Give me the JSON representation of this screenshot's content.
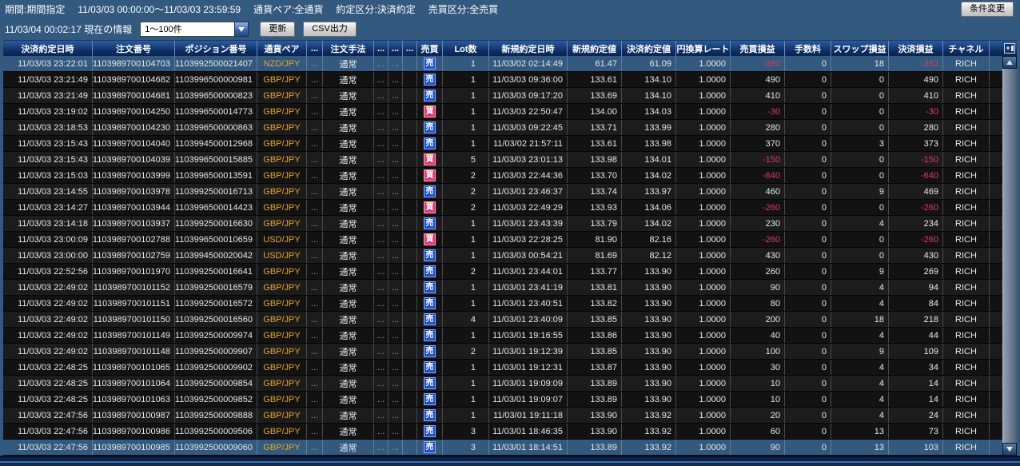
{
  "filter_bar": {
    "period_label": "期間:期間指定",
    "period_value": "11/03/03 00:00:00〜11/03/03 23:59:59",
    "pair_filter": "通貨ペア:全通貨",
    "type_filter": "約定区分:決済約定",
    "side_filter": "売買区分:全売買",
    "change_button": "条件変更"
  },
  "info_bar": {
    "timestamp": "11/03/04 00:02:17",
    "label": "現在の情報",
    "range_value": "1〜100件",
    "refresh_button": "更新",
    "csv_button": "CSV出力"
  },
  "colors": {
    "selection_blue": "#33597f",
    "sell_badge_blue": "#1d4fd6",
    "buy_badge_red": "#e8356a",
    "negative_red": "#e23a5f",
    "currency_orange": "#e2a62e",
    "header_navy": "#0d2d63"
  },
  "table": {
    "columns": [
      {
        "key": "dt",
        "label": "決済約定日時"
      },
      {
        "key": "order",
        "label": "注文番号"
      },
      {
        "key": "pos",
        "label": "ポジション番号"
      },
      {
        "key": "pair",
        "label": "通貨ペア"
      },
      {
        "key": "d1",
        "label": "..."
      },
      {
        "key": "method",
        "label": "注文手法"
      },
      {
        "key": "d2",
        "label": "..."
      },
      {
        "key": "d3",
        "label": "..."
      },
      {
        "key": "d4",
        "label": "..."
      },
      {
        "key": "side",
        "label": "売買"
      },
      {
        "key": "lots",
        "label": "Lot数"
      },
      {
        "key": "odt",
        "label": "新規約定日時"
      },
      {
        "key": "open",
        "label": "新規約定値"
      },
      {
        "key": "close",
        "label": "決済約定値"
      },
      {
        "key": "rate",
        "label": "円換算レート"
      },
      {
        "key": "pl",
        "label": "売買損益"
      },
      {
        "key": "fee",
        "label": "手数料"
      },
      {
        "key": "swap",
        "label": "スワップ損益"
      },
      {
        "key": "total",
        "label": "決済損益"
      },
      {
        "key": "ch",
        "label": "チャネル"
      }
    ],
    "rows": [
      {
        "dt": "11/03/03 23:22:01",
        "order": "1103989700104703",
        "pos": "1103992500021407",
        "pair": "NZD/JPY",
        "d1": "...",
        "method": "通常",
        "d2": "...",
        "d3": "...",
        "d4": "",
        "side": "売",
        "lots": "1",
        "odt": "11/03/02 02:14:49",
        "open": "61.47",
        "close": "61.09",
        "rate": "1.0000",
        "pl": "-380",
        "fee": "0",
        "swap": "18",
        "total": "-362",
        "ch": "RICH",
        "selected": true
      },
      {
        "dt": "11/03/03 23:21:49",
        "order": "1103989700104682",
        "pos": "1103996500000981",
        "pair": "GBP/JPY",
        "d1": "...",
        "method": "通常",
        "d2": "...",
        "d3": "...",
        "d4": "",
        "side": "売",
        "lots": "1",
        "odt": "11/03/03 09:36:00",
        "open": "133.61",
        "close": "134.10",
        "rate": "1.0000",
        "pl": "490",
        "fee": "0",
        "swap": "0",
        "total": "490",
        "ch": "RICH"
      },
      {
        "dt": "11/03/03 23:21:49",
        "order": "1103989700104681",
        "pos": "1103996500000823",
        "pair": "GBP/JPY",
        "d1": "...",
        "method": "通常",
        "d2": "...",
        "d3": "...",
        "d4": "",
        "side": "売",
        "lots": "1",
        "odt": "11/03/03 09:17:20",
        "open": "133.69",
        "close": "134.10",
        "rate": "1.0000",
        "pl": "410",
        "fee": "0",
        "swap": "0",
        "total": "410",
        "ch": "RICH"
      },
      {
        "dt": "11/03/03 23:19:02",
        "order": "1103989700104250",
        "pos": "1103996500014773",
        "pair": "GBP/JPY",
        "d1": "...",
        "method": "通常",
        "d2": "...",
        "d3": "...",
        "d4": "",
        "side": "買",
        "lots": "1",
        "odt": "11/03/03 22:50:47",
        "open": "134.00",
        "close": "134.03",
        "rate": "1.0000",
        "pl": "-30",
        "fee": "0",
        "swap": "0",
        "total": "-30",
        "ch": "RICH"
      },
      {
        "dt": "11/03/03 23:18:53",
        "order": "1103989700104230",
        "pos": "1103996500000863",
        "pair": "GBP/JPY",
        "d1": "...",
        "method": "通常",
        "d2": "...",
        "d3": "...",
        "d4": "",
        "side": "売",
        "lots": "1",
        "odt": "11/03/03 09:22:45",
        "open": "133.71",
        "close": "133.99",
        "rate": "1.0000",
        "pl": "280",
        "fee": "0",
        "swap": "0",
        "total": "280",
        "ch": "RICH"
      },
      {
        "dt": "11/03/03 23:15:43",
        "order": "1103989700104040",
        "pos": "1103994500012968",
        "pair": "GBP/JPY",
        "d1": "...",
        "method": "通常",
        "d2": "...",
        "d3": "...",
        "d4": "",
        "side": "売",
        "lots": "1",
        "odt": "11/03/02 21:57:11",
        "open": "133.61",
        "close": "133.98",
        "rate": "1.0000",
        "pl": "370",
        "fee": "0",
        "swap": "3",
        "total": "373",
        "ch": "RICH"
      },
      {
        "dt": "11/03/03 23:15:43",
        "order": "1103989700104039",
        "pos": "1103996500015885",
        "pair": "GBP/JPY",
        "d1": "...",
        "method": "通常",
        "d2": "...",
        "d3": "...",
        "d4": "",
        "side": "買",
        "lots": "5",
        "odt": "11/03/03 23:01:13",
        "open": "133.98",
        "close": "134.01",
        "rate": "1.0000",
        "pl": "-150",
        "fee": "0",
        "swap": "0",
        "total": "-150",
        "ch": "RICH"
      },
      {
        "dt": "11/03/03 23:15:03",
        "order": "1103989700103999",
        "pos": "1103996500013591",
        "pair": "GBP/JPY",
        "d1": "...",
        "method": "通常",
        "d2": "...",
        "d3": "...",
        "d4": "",
        "side": "買",
        "lots": "2",
        "odt": "11/03/03 22:44:36",
        "open": "133.70",
        "close": "134.02",
        "rate": "1.0000",
        "pl": "-640",
        "fee": "0",
        "swap": "0",
        "total": "-640",
        "ch": "RICH"
      },
      {
        "dt": "11/03/03 23:14:55",
        "order": "1103989700103978",
        "pos": "1103992500016713",
        "pair": "GBP/JPY",
        "d1": "...",
        "method": "通常",
        "d2": "...",
        "d3": "...",
        "d4": "",
        "side": "売",
        "lots": "2",
        "odt": "11/03/01 23:46:37",
        "open": "133.74",
        "close": "133.97",
        "rate": "1.0000",
        "pl": "460",
        "fee": "0",
        "swap": "9",
        "total": "469",
        "ch": "RICH"
      },
      {
        "dt": "11/03/03 23:14:27",
        "order": "1103989700103944",
        "pos": "1103996500014423",
        "pair": "GBP/JPY",
        "d1": "...",
        "method": "通常",
        "d2": "...",
        "d3": "...",
        "d4": "",
        "side": "買",
        "lots": "2",
        "odt": "11/03/03 22:49:29",
        "open": "133.93",
        "close": "134.06",
        "rate": "1.0000",
        "pl": "-260",
        "fee": "0",
        "swap": "0",
        "total": "-260",
        "ch": "RICH"
      },
      {
        "dt": "11/03/03 23:14:18",
        "order": "1103989700103937",
        "pos": "1103992500016630",
        "pair": "GBP/JPY",
        "d1": "...",
        "method": "通常",
        "d2": "...",
        "d3": "...",
        "d4": "",
        "side": "売",
        "lots": "1",
        "odt": "11/03/01 23:43:39",
        "open": "133.79",
        "close": "134.02",
        "rate": "1.0000",
        "pl": "230",
        "fee": "0",
        "swap": "4",
        "total": "234",
        "ch": "RICH"
      },
      {
        "dt": "11/03/03 23:00:09",
        "order": "1103989700102788",
        "pos": "1103996500010659",
        "pair": "USD/JPY",
        "d1": "...",
        "method": "通常",
        "d2": "...",
        "d3": "...",
        "d4": "",
        "side": "買",
        "lots": "1",
        "odt": "11/03/03 22:28:25",
        "open": "81.90",
        "close": "82.16",
        "rate": "1.0000",
        "pl": "-260",
        "fee": "0",
        "swap": "0",
        "total": "-260",
        "ch": "RICH"
      },
      {
        "dt": "11/03/03 23:00:00",
        "order": "1103989700102759",
        "pos": "1103994500020042",
        "pair": "USD/JPY",
        "d1": "...",
        "method": "通常",
        "d2": "...",
        "d3": "...",
        "d4": "",
        "side": "売",
        "lots": "1",
        "odt": "11/03/03 00:54:21",
        "open": "81.69",
        "close": "82.12",
        "rate": "1.0000",
        "pl": "430",
        "fee": "0",
        "swap": "0",
        "total": "430",
        "ch": "RICH"
      },
      {
        "dt": "11/03/03 22:52:56",
        "order": "1103989700101970",
        "pos": "1103992500016641",
        "pair": "GBP/JPY",
        "d1": "...",
        "method": "通常",
        "d2": "...",
        "d3": "...",
        "d4": "",
        "side": "売",
        "lots": "2",
        "odt": "11/03/01 23:44:01",
        "open": "133.77",
        "close": "133.90",
        "rate": "1.0000",
        "pl": "260",
        "fee": "0",
        "swap": "9",
        "total": "269",
        "ch": "RICH"
      },
      {
        "dt": "11/03/03 22:49:02",
        "order": "1103989700101152",
        "pos": "1103992500016579",
        "pair": "GBP/JPY",
        "d1": "...",
        "method": "通常",
        "d2": "...",
        "d3": "...",
        "d4": "",
        "side": "売",
        "lots": "1",
        "odt": "11/03/01 23:41:19",
        "open": "133.81",
        "close": "133.90",
        "rate": "1.0000",
        "pl": "90",
        "fee": "0",
        "swap": "4",
        "total": "94",
        "ch": "RICH"
      },
      {
        "dt": "11/03/03 22:49:02",
        "order": "1103989700101151",
        "pos": "1103992500016572",
        "pair": "GBP/JPY",
        "d1": "...",
        "method": "通常",
        "d2": "...",
        "d3": "...",
        "d4": "",
        "side": "売",
        "lots": "1",
        "odt": "11/03/01 23:40:51",
        "open": "133.82",
        "close": "133.90",
        "rate": "1.0000",
        "pl": "80",
        "fee": "0",
        "swap": "4",
        "total": "84",
        "ch": "RICH"
      },
      {
        "dt": "11/03/03 22:49:02",
        "order": "1103989700101150",
        "pos": "1103992500016560",
        "pair": "GBP/JPY",
        "d1": "...",
        "method": "通常",
        "d2": "...",
        "d3": "...",
        "d4": "",
        "side": "売",
        "lots": "4",
        "odt": "11/03/01 23:40:09",
        "open": "133.85",
        "close": "133.90",
        "rate": "1.0000",
        "pl": "200",
        "fee": "0",
        "swap": "18",
        "total": "218",
        "ch": "RICH"
      },
      {
        "dt": "11/03/03 22:49:02",
        "order": "1103989700101149",
        "pos": "1103992500009974",
        "pair": "GBP/JPY",
        "d1": "...",
        "method": "通常",
        "d2": "...",
        "d3": "...",
        "d4": "",
        "side": "売",
        "lots": "1",
        "odt": "11/03/01 19:16:55",
        "open": "133.86",
        "close": "133.90",
        "rate": "1.0000",
        "pl": "40",
        "fee": "0",
        "swap": "4",
        "total": "44",
        "ch": "RICH"
      },
      {
        "dt": "11/03/03 22:49:02",
        "order": "1103989700101148",
        "pos": "1103992500009907",
        "pair": "GBP/JPY",
        "d1": "...",
        "method": "通常",
        "d2": "...",
        "d3": "...",
        "d4": "",
        "side": "売",
        "lots": "2",
        "odt": "11/03/01 19:12:39",
        "open": "133.85",
        "close": "133.90",
        "rate": "1.0000",
        "pl": "100",
        "fee": "0",
        "swap": "9",
        "total": "109",
        "ch": "RICH"
      },
      {
        "dt": "11/03/03 22:48:25",
        "order": "1103989700101065",
        "pos": "1103992500009902",
        "pair": "GBP/JPY",
        "d1": "...",
        "method": "通常",
        "d2": "...",
        "d3": "...",
        "d4": "",
        "side": "売",
        "lots": "1",
        "odt": "11/03/01 19:12:31",
        "open": "133.87",
        "close": "133.90",
        "rate": "1.0000",
        "pl": "30",
        "fee": "0",
        "swap": "4",
        "total": "34",
        "ch": "RICH"
      },
      {
        "dt": "11/03/03 22:48:25",
        "order": "1103989700101064",
        "pos": "1103992500009854",
        "pair": "GBP/JPY",
        "d1": "...",
        "method": "通常",
        "d2": "...",
        "d3": "...",
        "d4": "",
        "side": "売",
        "lots": "1",
        "odt": "11/03/01 19:09:09",
        "open": "133.89",
        "close": "133.90",
        "rate": "1.0000",
        "pl": "10",
        "fee": "0",
        "swap": "4",
        "total": "14",
        "ch": "RICH"
      },
      {
        "dt": "11/03/03 22:48:25",
        "order": "1103989700101063",
        "pos": "1103992500009852",
        "pair": "GBP/JPY",
        "d1": "...",
        "method": "通常",
        "d2": "...",
        "d3": "...",
        "d4": "",
        "side": "売",
        "lots": "1",
        "odt": "11/03/01 19:09:07",
        "open": "133.89",
        "close": "133.90",
        "rate": "1.0000",
        "pl": "10",
        "fee": "0",
        "swap": "4",
        "total": "14",
        "ch": "RICH"
      },
      {
        "dt": "11/03/03 22:47:56",
        "order": "1103989700100987",
        "pos": "1103992500009888",
        "pair": "GBP/JPY",
        "d1": "...",
        "method": "通常",
        "d2": "...",
        "d3": "...",
        "d4": "",
        "side": "売",
        "lots": "1",
        "odt": "11/03/01 19:11:18",
        "open": "133.90",
        "close": "133.92",
        "rate": "1.0000",
        "pl": "20",
        "fee": "0",
        "swap": "4",
        "total": "24",
        "ch": "RICH"
      },
      {
        "dt": "11/03/03 22:47:56",
        "order": "1103989700100986",
        "pos": "1103992500009506",
        "pair": "GBP/JPY",
        "d1": "...",
        "method": "通常",
        "d2": "...",
        "d3": "...",
        "d4": "",
        "side": "売",
        "lots": "3",
        "odt": "11/03/01 18:46:35",
        "open": "133.90",
        "close": "133.92",
        "rate": "1.0000",
        "pl": "60",
        "fee": "0",
        "swap": "13",
        "total": "73",
        "ch": "RICH"
      },
      {
        "dt": "11/03/03 22:47:56",
        "order": "1103989700100985",
        "pos": "1103992500009060",
        "pair": "GBP/JPY",
        "d1": "...",
        "method": "通常",
        "d2": "...",
        "d3": "...",
        "d4": "",
        "side": "売",
        "lots": "3",
        "odt": "11/03/01 18:14:51",
        "open": "133.89",
        "close": "133.92",
        "rate": "1.0000",
        "pl": "90",
        "fee": "0",
        "swap": "13",
        "total": "103",
        "ch": "RICH",
        "selected": true
      }
    ]
  }
}
